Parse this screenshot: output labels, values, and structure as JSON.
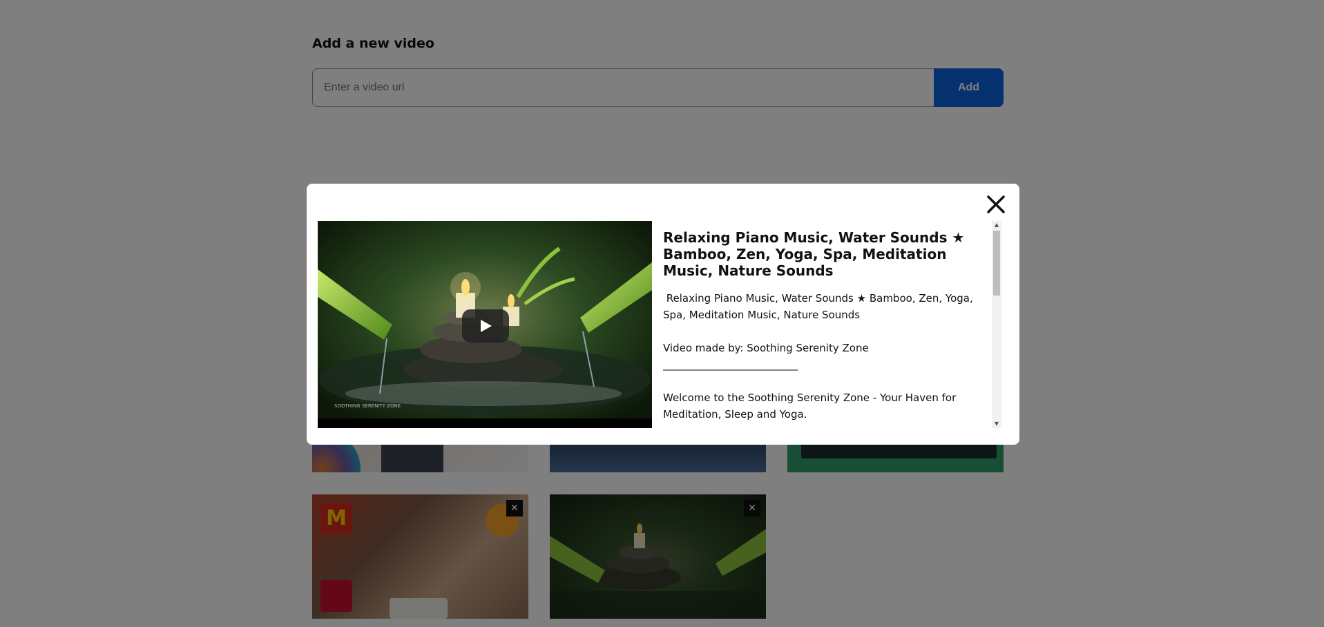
{
  "add_video": {
    "heading": "Add a new video",
    "url_placeholder": "Enter a video url",
    "url_value": "",
    "add_label": "Add"
  },
  "thumbnails": {
    "remove_label": "✕"
  },
  "modal": {
    "close_icon": "close-icon",
    "title": "Relaxing Piano Music, Water Sounds ★ Bamboo, Zen, Yoga, Spa, Meditation Music, Nature Sounds",
    "description": " Relaxing Piano Music, Water Sounds ★ Bamboo, Zen, Yoga, Spa, Meditation Music, Nature Sounds\n\nVideo made by: Soothing Serenity Zone\n__________________________\n\nWelcome to the Soothing Serenity Zone - Your Haven for Meditation, Sleep and Yoga.",
    "player_watermark": "SOOTHING SERENITY ZONE",
    "play_icon": "play-icon"
  },
  "colors": {
    "accent": "#0d63de",
    "overlay": "rgba(0,0,0,0.5)"
  }
}
